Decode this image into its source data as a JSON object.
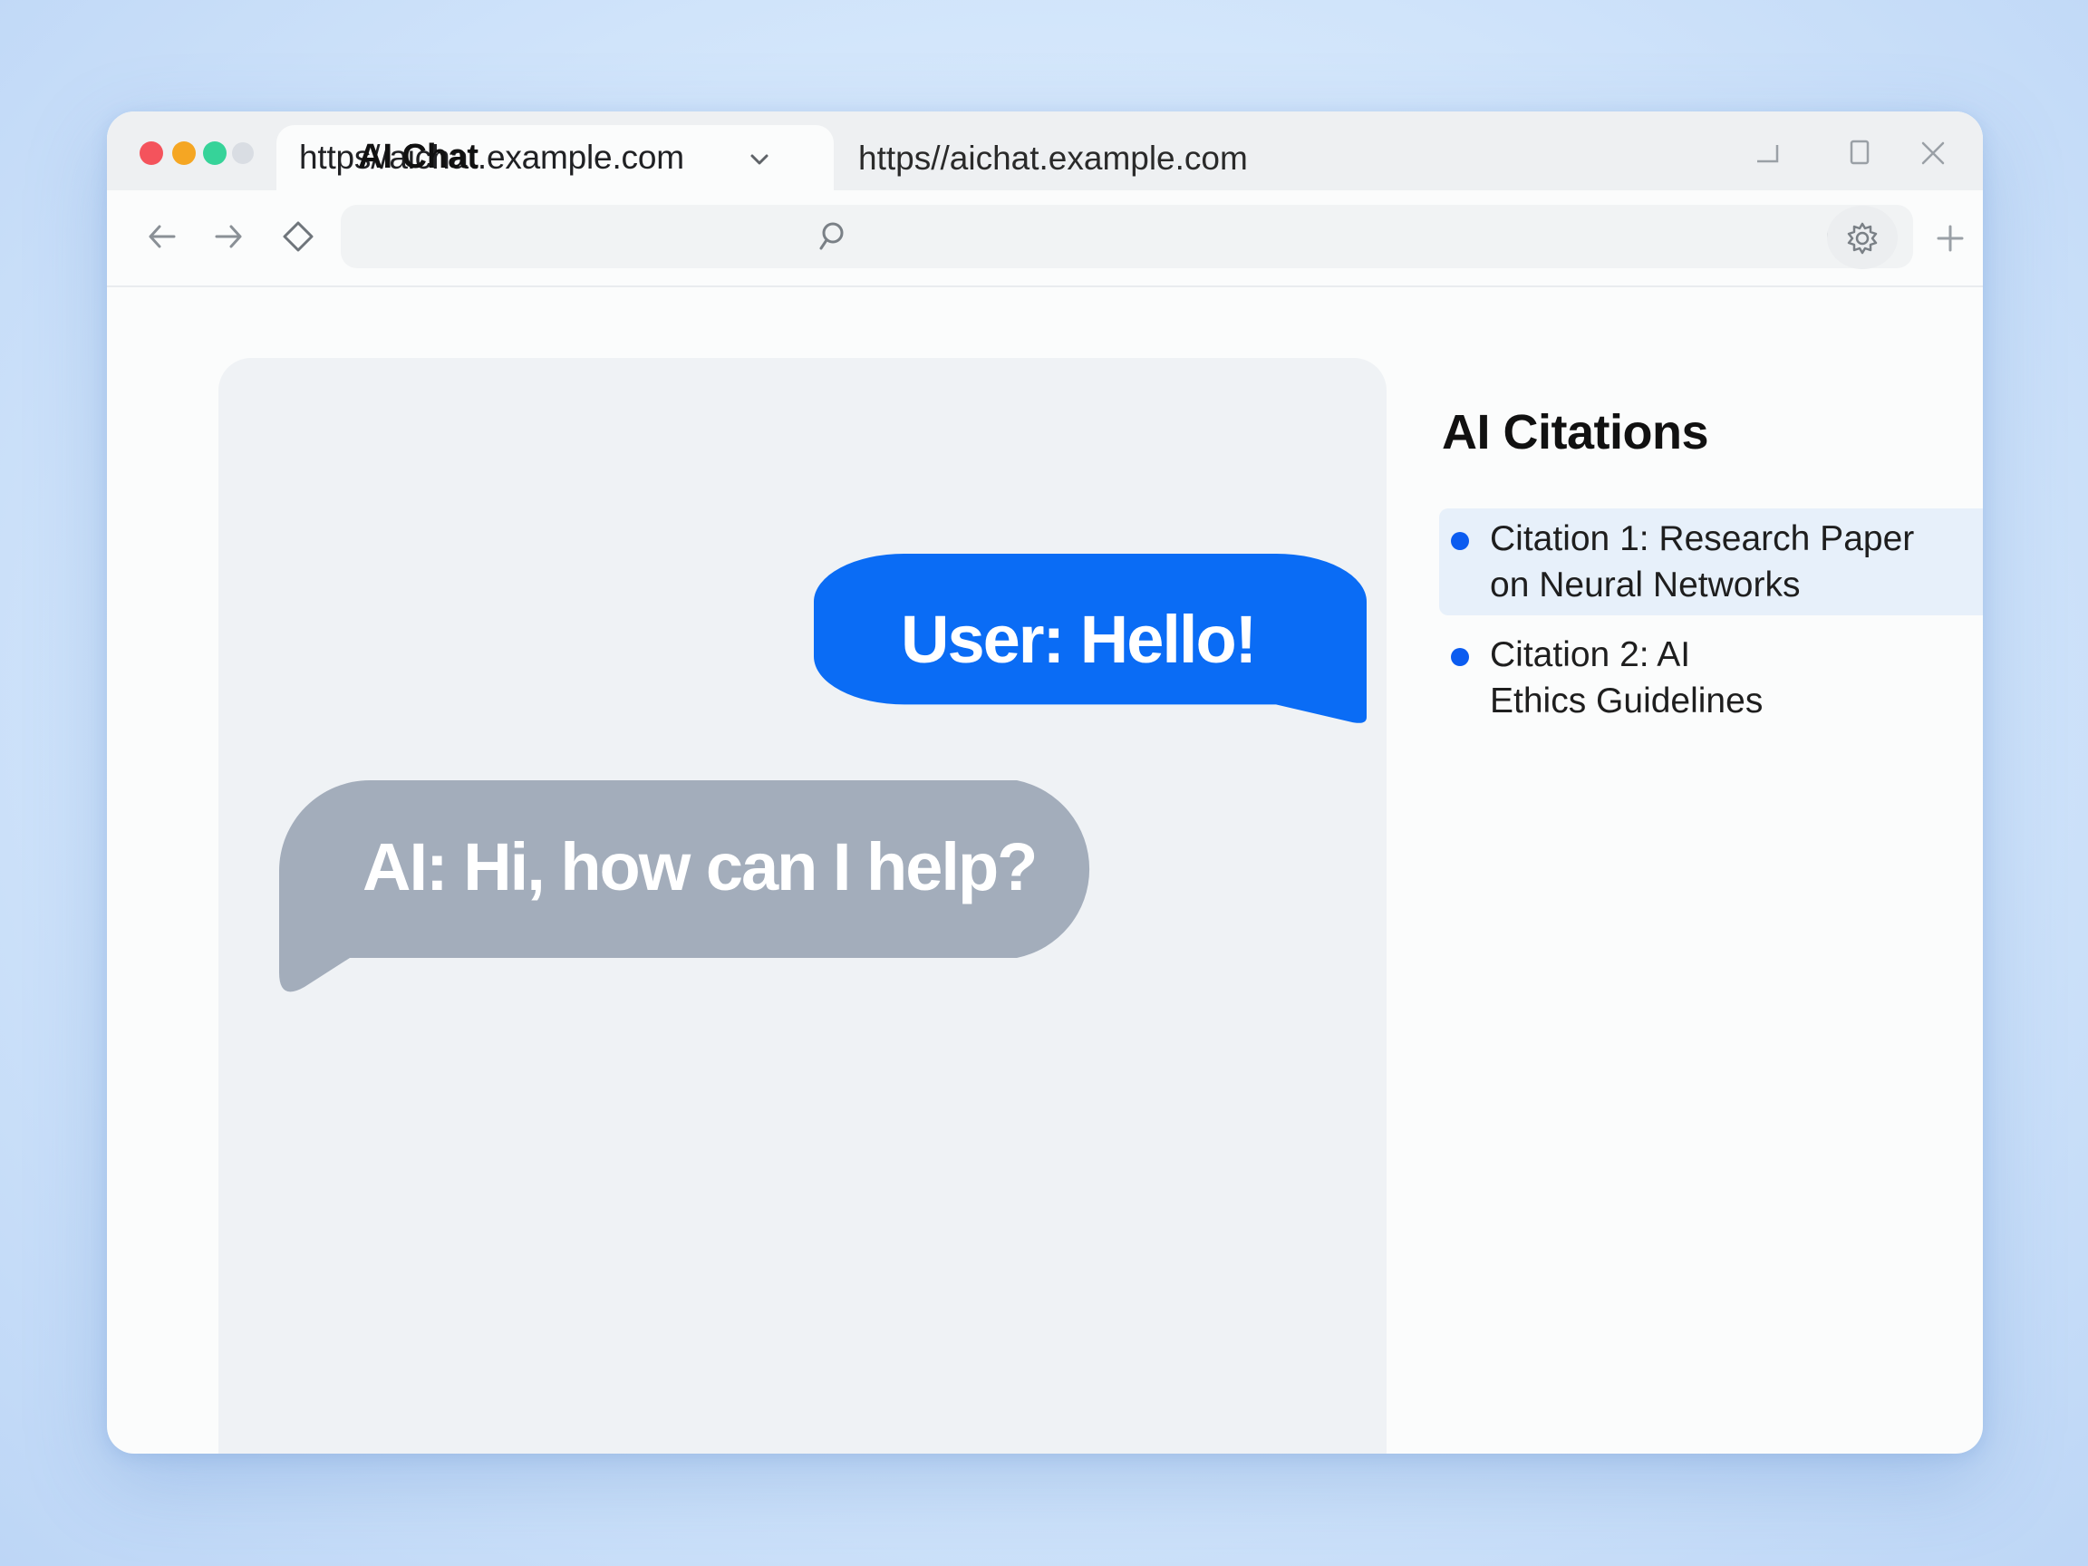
{
  "window": {
    "traffic_lights": [
      "#f4535c",
      "#f5a623",
      "#36d399",
      "#d9dde3"
    ]
  },
  "tab": {
    "title": "https//aichat.example.com",
    "dropdown_icon": "chevron-down-icon"
  },
  "window_controls": {
    "icons": [
      "minimize-icon",
      "maximize-icon",
      "close-icon"
    ]
  },
  "toolbar": {
    "back_icon": "arrow-left-icon",
    "forward_icon": "arrow-right-icon",
    "bookmark_icon": "diamond-icon",
    "site_title": "AI Chat",
    "search_icon": "search-icon",
    "url": "https//aichat.example.com",
    "reload_icon": "reload-icon",
    "extension_icon": "gear-icon",
    "new_tab_icon": "plus-icon"
  },
  "chat": {
    "messages": [
      {
        "role": "user",
        "text": "User: Hello!",
        "color": "#0a6cf5"
      },
      {
        "role": "ai",
        "text": "AI: Hi, how can I help?",
        "color": "#a3adbb"
      }
    ]
  },
  "citations": {
    "heading": "AI Citations",
    "bullet_color": "#0b5cf0",
    "items": [
      {
        "line1": "Citation 1: Research Paper",
        "line2": "on Neural Networks",
        "highlighted": true
      },
      {
        "line1": "Citation 2: AI",
        "line2": "Ethics Guidelines",
        "highlighted": false
      }
    ]
  }
}
